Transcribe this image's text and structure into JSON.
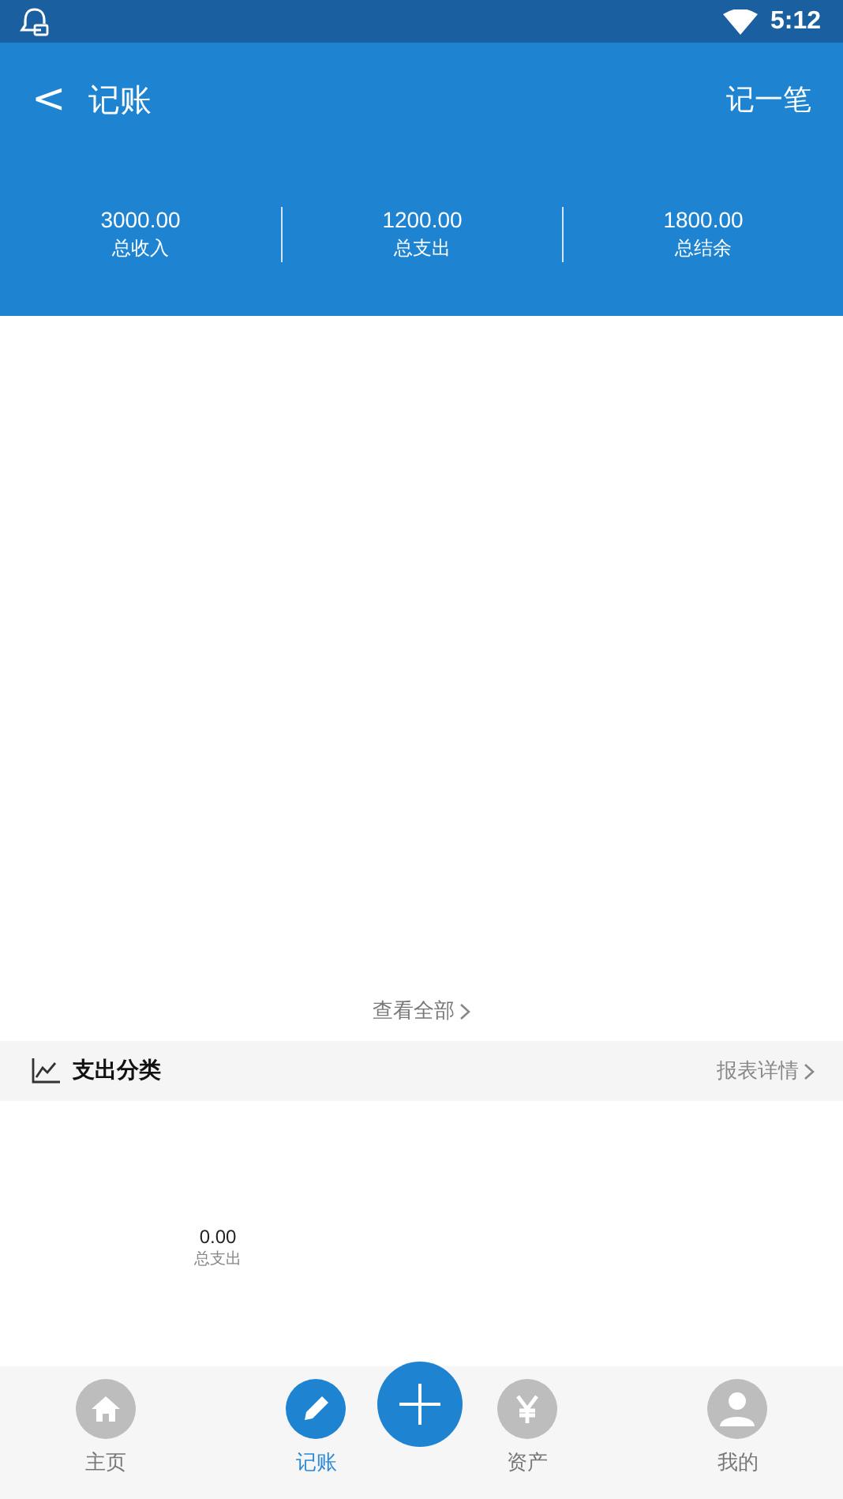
{
  "status_bar": {
    "time": "5:12"
  },
  "header": {
    "back": "<",
    "title": "记账",
    "action": "记一笔"
  },
  "summary": [
    {
      "value": "3000.00",
      "label": "总收入"
    },
    {
      "value": "1200.00",
      "label": "总支出"
    },
    {
      "value": "1800.00",
      "label": "总结余"
    }
  ],
  "view_all": "查看全部",
  "section": {
    "title": "支出分类",
    "link": "报表详情"
  },
  "chart_center": {
    "value": "0.00",
    "label": "总支出"
  },
  "nav": [
    {
      "label": "主页",
      "kind": "home",
      "selected": false
    },
    {
      "label": "记账",
      "kind": "pencil",
      "selected": true
    },
    {
      "label": "资产",
      "kind": "yen",
      "selected": false
    },
    {
      "label": "我的",
      "kind": "user",
      "selected": false
    }
  ]
}
